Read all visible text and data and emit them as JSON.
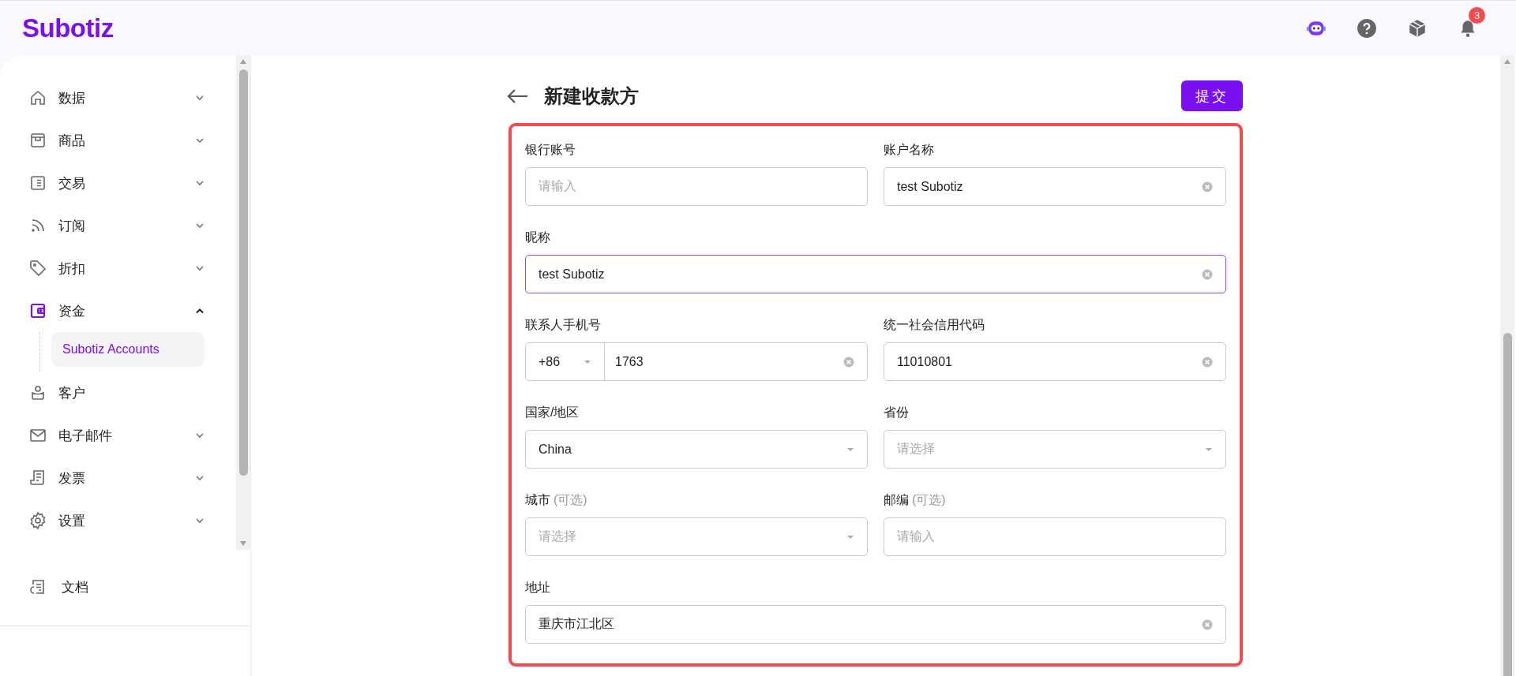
{
  "header": {
    "logo": "Subotiz",
    "notification_count": "3"
  },
  "sidebar": {
    "items": [
      {
        "label": "数据",
        "expandable": true,
        "expanded": false,
        "selected": false
      },
      {
        "label": "商品",
        "expandable": true,
        "expanded": false,
        "selected": false
      },
      {
        "label": "交易",
        "expandable": true,
        "expanded": false,
        "selected": false
      },
      {
        "label": "订阅",
        "expandable": true,
        "expanded": false,
        "selected": false
      },
      {
        "label": "折扣",
        "expandable": true,
        "expanded": false,
        "selected": false
      },
      {
        "label": "资金",
        "expandable": true,
        "expanded": true,
        "selected": true,
        "children": [
          {
            "label": "Subotiz Accounts",
            "selected": true
          }
        ]
      },
      {
        "label": "客户",
        "expandable": false,
        "selected": false
      },
      {
        "label": "电子邮件",
        "expandable": true,
        "expanded": false,
        "selected": false
      },
      {
        "label": "发票",
        "expandable": true,
        "expanded": false,
        "selected": false
      },
      {
        "label": "设置",
        "expandable": true,
        "expanded": false,
        "selected": false
      }
    ],
    "footer_link": {
      "label": "文档"
    }
  },
  "page": {
    "title": "新建收款方",
    "submit": "提交"
  },
  "form": {
    "rows": [
      [
        {
          "label": "银行账号",
          "kind": "text",
          "placeholder": "请输入",
          "clearable": false,
          "focused": false
        },
        {
          "label": "账户名称",
          "kind": "text",
          "value": "test Subotiz",
          "clearable": true,
          "focused": false
        }
      ],
      [
        {
          "label": "昵称",
          "kind": "text",
          "value": "test Subotiz",
          "clearable": true,
          "focused": true
        }
      ],
      [
        {
          "label": "联系人手机号",
          "kind": "phone",
          "country_code": "+86",
          "value": "1763",
          "clearable": true,
          "focused": false
        },
        {
          "label": "统一社会信用代码",
          "kind": "text",
          "value": "11010801",
          "clearable": true,
          "focused": false
        }
      ],
      [
        {
          "label": "国家/地区",
          "kind": "select",
          "value": "China",
          "clearable": false,
          "focused": false
        },
        {
          "label": "省份",
          "kind": "select",
          "placeholder": "请选择",
          "clearable": false,
          "focused": false
        }
      ],
      [
        {
          "label": "城市",
          "optional": "(可选)",
          "kind": "select",
          "placeholder": "请选择",
          "clearable": false,
          "focused": false
        },
        {
          "label": "邮编",
          "optional": "(可选)",
          "kind": "text",
          "placeholder": "请输入",
          "clearable": false,
          "focused": false
        }
      ],
      [
        {
          "label": "地址",
          "kind": "text",
          "value": "重庆市江北区",
          "clearable": true,
          "focused": false
        }
      ]
    ]
  }
}
